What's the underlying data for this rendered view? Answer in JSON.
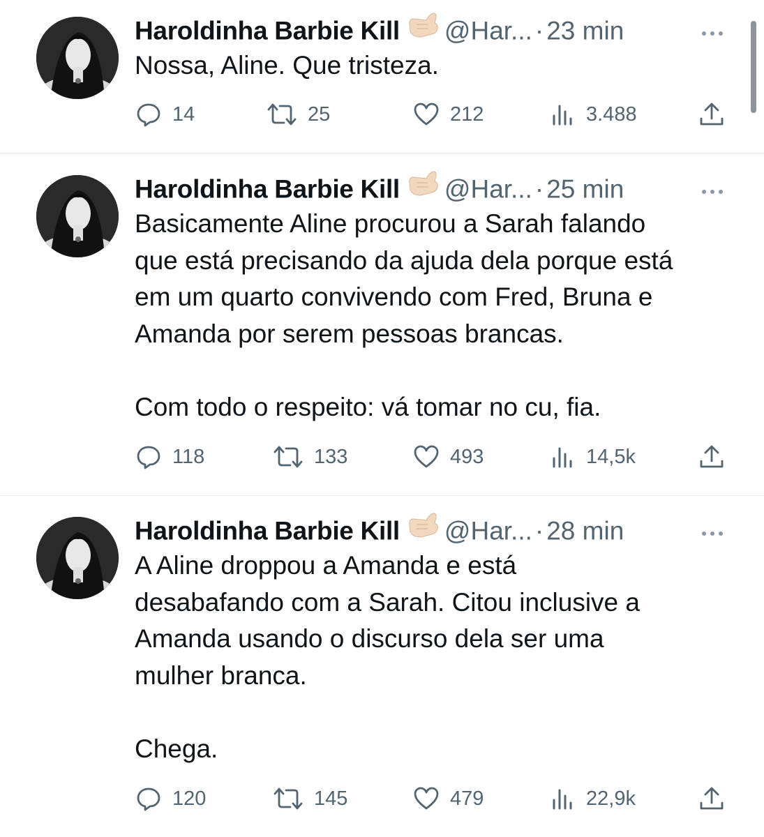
{
  "tweets": [
    {
      "author": {
        "name": "Haroldinha Barbie Kill",
        "emoji": "🤙🏻",
        "handle": "@Har...",
        "separator": "·",
        "time": "23 min"
      },
      "text": "Nossa, Aline. Que tristeza.",
      "actions": {
        "replies": "14",
        "retweets": "25",
        "likes": "212",
        "views": "3.488"
      }
    },
    {
      "author": {
        "name": "Haroldinha Barbie Kill",
        "emoji": "🤙🏻",
        "handle": "@Har...",
        "separator": "·",
        "time": "25 min"
      },
      "text": "Basicamente Aline procurou a Sarah falando\nque está precisando da ajuda dela porque está\nem um quarto convivendo com Fred, Bruna e\nAmanda por serem pessoas brancas.\n\nCom todo o respeito: vá tomar no cu, fia.",
      "actions": {
        "replies": "118",
        "retweets": "133",
        "likes": "493",
        "views": "14,5k"
      }
    },
    {
      "author": {
        "name": "Haroldinha Barbie Kill",
        "emoji": "🤙🏻",
        "handle": "@Har...",
        "separator": "·",
        "time": "28 min"
      },
      "text": "A Aline droppou a Amanda e está\ndesabafando com a Sarah. Citou inclusive a\nAmanda usando o discurso dela ser uma\nmulher branca.\n\nChega.",
      "actions": {
        "replies": "120",
        "retweets": "145",
        "likes": "479",
        "views": "22,9k"
      }
    }
  ],
  "colors": {
    "text_primary": "#0f1419",
    "text_secondary": "#536471",
    "divider": "#e6e9ec"
  },
  "icons": {
    "reply": "speech-bubble",
    "retweet": "retweet-arrows",
    "like": "heart",
    "views": "bar-chart",
    "share": "upload-arrow",
    "more": "three-dots",
    "hand": "call-me-hand-emoji"
  }
}
